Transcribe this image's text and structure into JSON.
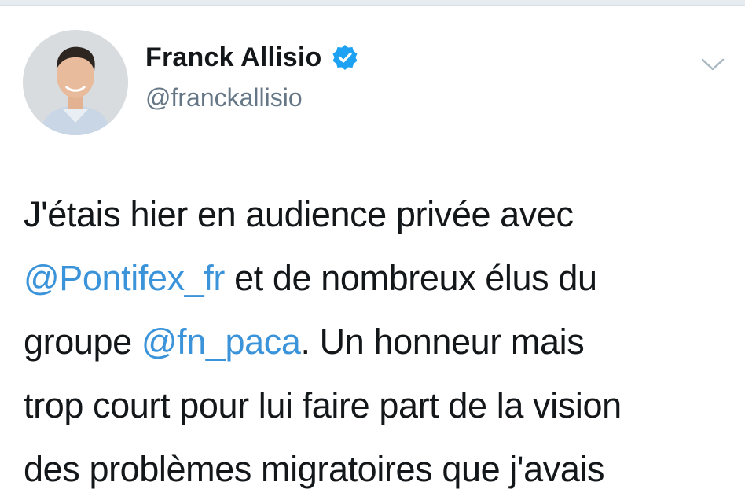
{
  "tweet": {
    "author": {
      "name": "Franck Allisio",
      "handle": "@franckallisio",
      "verified": true,
      "avatar_icon": "profile-photo"
    },
    "menu_icon": "chevron-down-icon",
    "text_lines": [
      [
        "J'étais hier en audience privée avec"
      ],
      [
        "@Pontifex_fr",
        " et de nombreux élus du"
      ],
      [
        "groupe ",
        "@fn_paca",
        ". Un honneur mais"
      ],
      [
        "trop court pour lui faire part de la vision"
      ],
      [
        "des problèmes migratoires que j'avais"
      ]
    ],
    "mentions": [
      "@Pontifex_fr",
      "@fn_paca"
    ]
  },
  "colors": {
    "text": "#14171a",
    "secondary": "#657786",
    "link": "#3b94d9",
    "verified": "#1da1f2",
    "divider": "#e6ecf0"
  }
}
